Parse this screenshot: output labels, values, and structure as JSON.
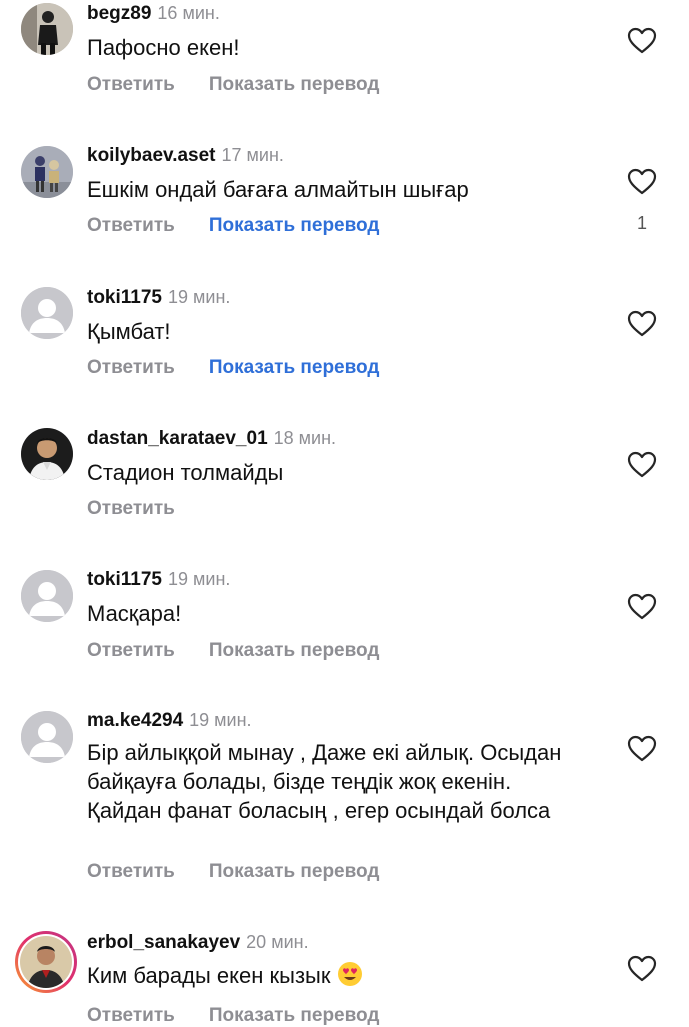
{
  "colors": {
    "username": "#111111",
    "muted": "#8e8e93",
    "translate_active": "#2f6fd8",
    "avatar_placeholder": "#c7c7cc"
  },
  "labels": {
    "reply": "Ответить",
    "translate": "Показать перевод"
  },
  "comments": [
    {
      "username": "begz89",
      "time": "16 мин.",
      "text": "Пафосно екен!",
      "translate_highlighted": false,
      "likes": "",
      "avatar": "photo-dark-figure"
    },
    {
      "username": "koilybaev.aset",
      "time": "17 мин.",
      "text": "Ешкім ондай бағаға алмайтын шығар",
      "translate_highlighted": true,
      "likes": "1",
      "avatar": "photo-two-kids"
    },
    {
      "username": "toki1175",
      "time": "19 мин.",
      "text": "Қымбат!",
      "translate_highlighted": true,
      "likes": "",
      "avatar": "default-silhouette"
    },
    {
      "username": "dastan_karataev_01",
      "time": "18 мин.",
      "text": "Стадион толмайды",
      "translate_highlighted": false,
      "likes": "",
      "avatar": "photo-man"
    },
    {
      "username": "toki1175",
      "time": "19 мин.",
      "text": "Масқара!",
      "translate_highlighted": false,
      "likes": "",
      "avatar": "default-silhouette"
    },
    {
      "username": "ma.ke4294",
      "time": "19 мин.",
      "text": "Бір айлыққой мынау , Даже екі айлық. Осыдан байқауға болады, бізде теңдік жоқ екенін. Қайдан фанат боласың , егер осындай болса",
      "translate_highlighted": false,
      "likes": "",
      "avatar": "default-silhouette"
    },
    {
      "username": "erbol_sanakayev",
      "time": "20 мин.",
      "text": "Ким барады екен кызык",
      "emoji": "heart-eyes-emoji",
      "translate_highlighted": false,
      "likes": "",
      "avatar": "photo-story-ring"
    }
  ]
}
